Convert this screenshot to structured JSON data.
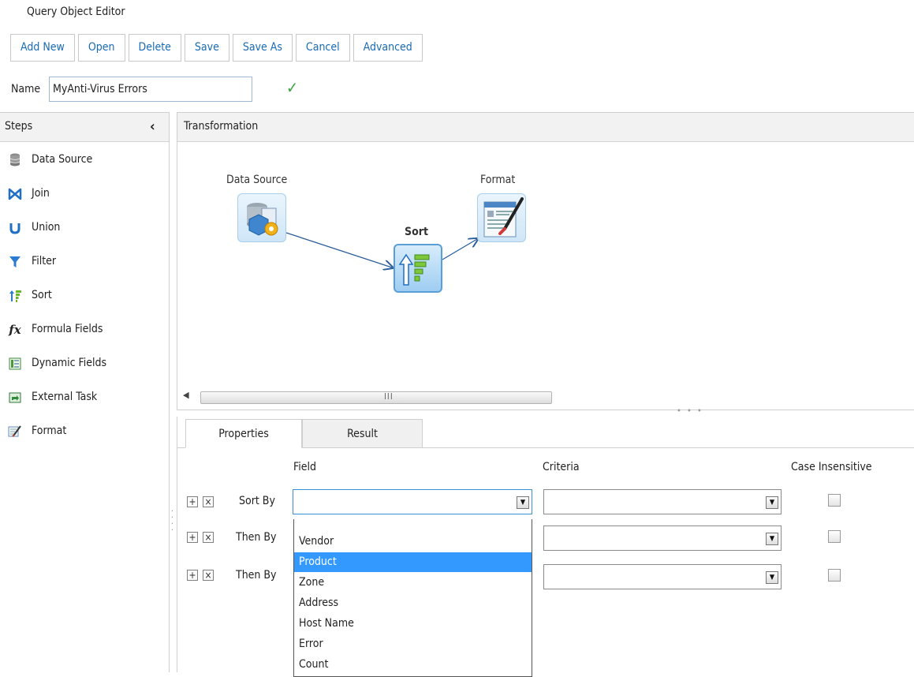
{
  "app_title": "Query Object Editor",
  "toolbar": {
    "buttons": [
      "Add New",
      "Open",
      "Delete",
      "Save",
      "Save As",
      "Cancel",
      "Advanced"
    ]
  },
  "name_field": {
    "label": "Name",
    "value": "MyAnti-Virus Errors"
  },
  "steps": {
    "title": "Steps",
    "items": [
      {
        "label": "Data Source",
        "icon": "database-icon"
      },
      {
        "label": "Join",
        "icon": "join-icon"
      },
      {
        "label": "Union",
        "icon": "union-icon"
      },
      {
        "label": "Filter",
        "icon": "filter-icon"
      },
      {
        "label": "Sort",
        "icon": "sort-icon"
      },
      {
        "label": "Formula Fields",
        "icon": "formula-icon"
      },
      {
        "label": "Dynamic Fields",
        "icon": "dynamic-fields-icon"
      },
      {
        "label": "External Task",
        "icon": "external-task-icon"
      },
      {
        "label": "Format",
        "icon": "format-icon"
      }
    ]
  },
  "transformation": {
    "title": "Transformation",
    "nodes": [
      {
        "label": "Data Source"
      },
      {
        "label": "Sort"
      },
      {
        "label": "Format"
      }
    ],
    "scrollbar_grip": "III"
  },
  "tabs": [
    "Properties",
    "Result"
  ],
  "sort_table": {
    "headers": {
      "field": "Field",
      "criteria": "Criteria",
      "case": "Case Insensitive"
    },
    "rows": [
      {
        "label": "Sort By",
        "field": "",
        "criteria": "",
        "case_insensitive": false
      },
      {
        "label": "Then By",
        "field": "",
        "criteria": "",
        "case_insensitive": false
      },
      {
        "label": "Then By",
        "field": "",
        "criteria": "",
        "case_insensitive": false
      }
    ]
  },
  "field_dropdown": {
    "options": [
      "",
      "Vendor",
      "Product",
      "Zone",
      "Address",
      "Host Name",
      "Error",
      "Count"
    ],
    "highlighted": "Product"
  },
  "colors": {
    "link_blue": "#1a6bb5",
    "highlight": "#3399ff",
    "valid_green": "#3aa33a"
  }
}
